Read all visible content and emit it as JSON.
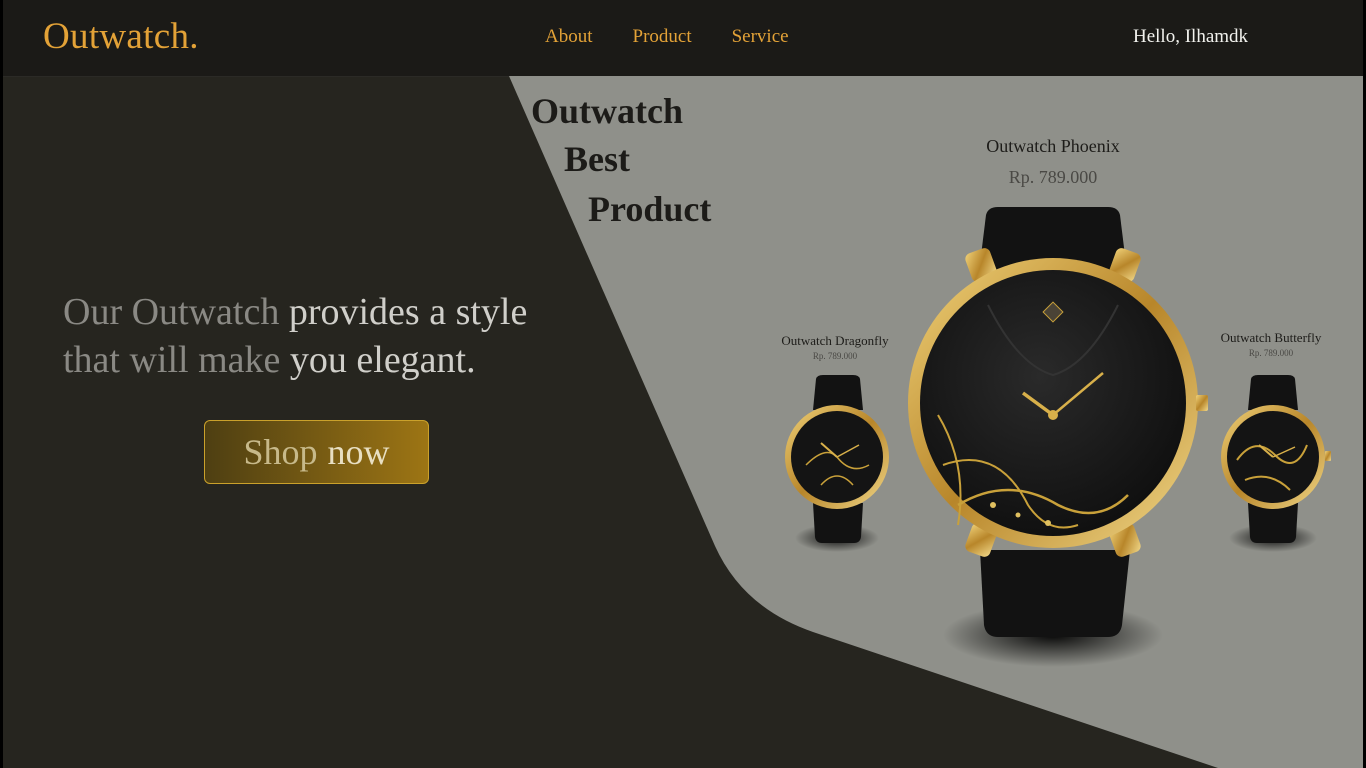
{
  "brand": {
    "logo": "Outwatch."
  },
  "nav": {
    "items": [
      "About",
      "Product",
      "Service"
    ]
  },
  "user": {
    "greeting": "Hello, Ilhamdk"
  },
  "hero": {
    "line1_part1": "Our Outwatch ",
    "line1_part2": "provides a style",
    "line2_part1": "that will make ",
    "line2_part2": "you elegant.",
    "cta_part1": "Shop",
    "cta_part2": "now"
  },
  "section": {
    "title_lines": [
      "Outwatch",
      "Best",
      "Product"
    ]
  },
  "products": [
    {
      "name": "Outwatch Dragonfly",
      "price": "Rp. 789.000"
    },
    {
      "name": "Outwatch Phoenix",
      "price": "Rp. 789.000"
    },
    {
      "name": "Outwatch Butterfly",
      "price": "Rp. 789.000"
    }
  ],
  "colors": {
    "accent": "#e3a237",
    "dark": "#26251f",
    "panel": "#8f908a",
    "gold": "#c9a13a"
  }
}
